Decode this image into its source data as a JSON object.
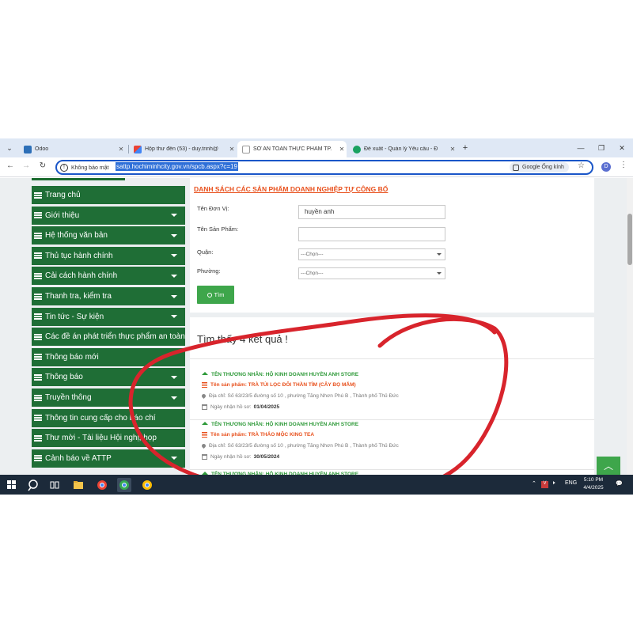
{
  "tabs": [
    {
      "label": "Odoo",
      "icon": "odoo-icon",
      "active": false
    },
    {
      "label": "Hộp thư đến (53) - duy.trinh@",
      "icon": "gmail-icon",
      "active": false
    },
    {
      "label": "SỞ AN TOÀN THỰC PHẨM TP.",
      "icon": "page-icon",
      "active": true
    },
    {
      "label": "Đề xuất - Quản lý Yêu cầu - Đ",
      "icon": "app-icon",
      "active": false
    }
  ],
  "addressbar": {
    "security": "Không bảo mật",
    "url": "sattp.hochiminhcity.gov.vn/spcb.aspx?c=19",
    "lens": "Google Ống kính",
    "profile": "D"
  },
  "sidebar": {
    "items": [
      {
        "label": "Trang chủ",
        "caret": false
      },
      {
        "label": "Giới thiệu",
        "caret": true
      },
      {
        "label": "Hệ thống văn bản",
        "caret": true
      },
      {
        "label": "Thủ tục hành chính",
        "caret": true
      },
      {
        "label": "Cải cách hành chính",
        "caret": true
      },
      {
        "label": "Thanh tra, kiểm tra",
        "caret": true
      },
      {
        "label": "Tin tức - Sự kiện",
        "caret": true
      },
      {
        "label": "Các đề án phát triển thực phẩm an toàn",
        "caret": false
      },
      {
        "label": "Thông báo mới",
        "caret": false
      },
      {
        "label": "Thông báo",
        "caret": true
      },
      {
        "label": "Truyền thông",
        "caret": true
      },
      {
        "label": "Thông tin cung cấp cho báo chí",
        "caret": false
      },
      {
        "label": "Thư mời - Tài liệu Hội nghị, họp",
        "caret": false
      },
      {
        "label": "Cảnh báo về ATTP",
        "caret": true
      }
    ]
  },
  "search_form": {
    "title": "DANH SÁCH CÁC SẢN PHẨM DOANH NGHIỆP TỰ CÔNG BỐ",
    "unit_label": "Tên Đơn Vị:",
    "unit_value": "huyền anh",
    "product_label": "Tên Sản Phẩm:",
    "product_value": "",
    "district_label": "Quận:",
    "district_value": "---Chọn---",
    "ward_label": "Phường:",
    "ward_value": "---Chọn---",
    "button": "Tìm"
  },
  "results": {
    "count_text": "Tìm thấy 4 kết quả !",
    "items": [
      {
        "trader": "TÊN THƯƠNG NHÂN: HỘ KINH DOANH HUYỀN ANH STORE",
        "product": "Tên sản phẩm: TRÀ TÚI LỌC ĐÔI THẦN TÌM (CÂY BỌ MẮM)",
        "address": "Địa chỉ: Số 63/23/5 đường số 10 , phường Tăng Nhơn Phú B , Thành phố Thủ Đức",
        "date_label": "Ngày nhận hồ sơ:",
        "date": "01/04/2025"
      },
      {
        "trader": "TÊN THƯƠNG NHÂN: HỘ KINH DOANH HUYỀN ANH STORE",
        "product": "Tên sản phẩm: TRÀ THẢO MỘC KING TEA",
        "address": "Địa chỉ: Số 63/23/5 đường số 10 , phường Tăng Nhơn Phú B , Thành phố Thủ Đức",
        "date_label": "Ngày nhận hồ sơ:",
        "date": "30/05/2024"
      },
      {
        "trader": "TÊN THƯƠNG NHÂN: HỘ KINH DOANH HUYỀN ANH STORE",
        "product": "",
        "address": "",
        "date_label": "",
        "date": ""
      }
    ]
  },
  "taskbar": {
    "time": "5:10 PM",
    "date": "4/4/2025",
    "lang": "ENG"
  },
  "colors": {
    "sidebar_green": "#1f6e36",
    "accent_orange": "#e8501c",
    "trader_green": "#2f9a3a",
    "button_green": "#3ea64b",
    "annotation_red": "#d8242c",
    "url_highlight": "#2e6fd8"
  }
}
